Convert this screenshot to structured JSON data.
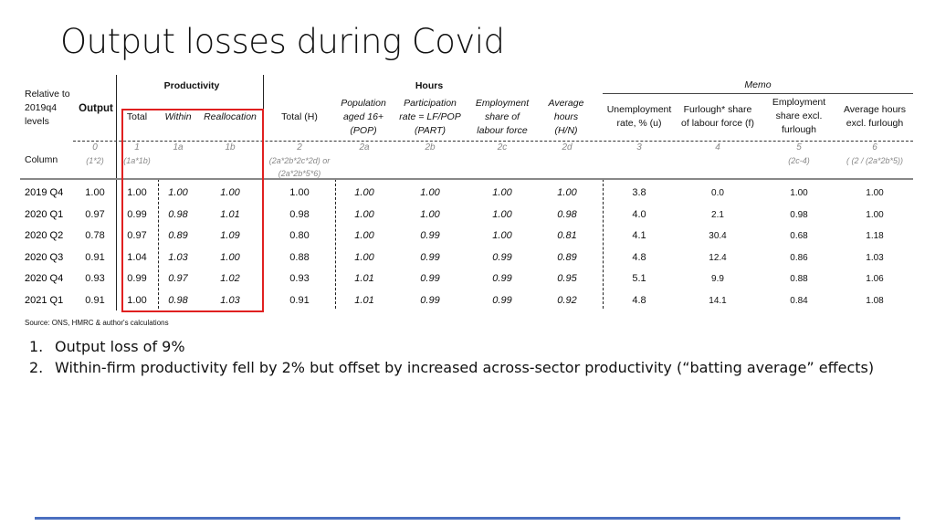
{
  "title": "Output losses during Covid",
  "table": {
    "row_header_label": "Relative to 2019q4 levels",
    "column_row_label": "Column",
    "groups": {
      "productivity": "Productivity",
      "hours": "Hours",
      "memo": "Memo"
    },
    "columns": [
      {
        "key": "output",
        "label": "Output",
        "id": "0",
        "formula": "(1*2)"
      },
      {
        "key": "prod_total",
        "label": "Total",
        "id": "1",
        "formula": "(1a*1b)"
      },
      {
        "key": "prod_within",
        "label": "Within",
        "id": "1a",
        "formula": ""
      },
      {
        "key": "prod_realloc",
        "label": "Reallocation",
        "id": "1b",
        "formula": ""
      },
      {
        "key": "hours_total",
        "label": "Total (H)",
        "id": "2",
        "formula": "(2a*2b*2c*2d) or",
        "formula2": "(2a*2b*5*6)"
      },
      {
        "key": "pop",
        "label_lines": [
          "Population",
          "aged 16+",
          "(POP)"
        ],
        "id": "2a",
        "formula": ""
      },
      {
        "key": "part",
        "label_lines": [
          "Participation",
          "rate = LF/POP",
          "(PART)"
        ],
        "id": "2b",
        "formula": ""
      },
      {
        "key": "emp_share",
        "label_lines": [
          "Employment",
          "share of",
          "labour force"
        ],
        "id": "2c",
        "formula": ""
      },
      {
        "key": "avg_hours",
        "label_lines": [
          "Average",
          "hours",
          "(H/N)"
        ],
        "id": "2d",
        "formula": ""
      },
      {
        "key": "unemp",
        "label_lines": [
          "Unemployment",
          "rate, % (u)"
        ],
        "id": "3",
        "formula": ""
      },
      {
        "key": "furlough",
        "label_lines": [
          "Furlough* share",
          "of labour force (f)"
        ],
        "id": "4",
        "formula": ""
      },
      {
        "key": "emp_excl",
        "label_lines": [
          "Employment",
          "share excl.",
          "furlough"
        ],
        "id": "5",
        "formula": "(2c-4)"
      },
      {
        "key": "hours_excl",
        "label_lines": [
          "Average hours",
          "excl. furlough"
        ],
        "id": "6",
        "formula": "( (2 / (2a*2b*5))"
      }
    ],
    "rows": [
      {
        "period": "2019 Q4",
        "values": [
          "1.00",
          "1.00",
          "1.00",
          "1.00",
          "1.00",
          "1.00",
          "1.00",
          "1.00",
          "1.00",
          "3.8",
          "0.0",
          "1.00",
          "1.00"
        ]
      },
      {
        "period": "2020 Q1",
        "values": [
          "0.97",
          "0.99",
          "0.98",
          "1.01",
          "0.98",
          "1.00",
          "1.00",
          "1.00",
          "0.98",
          "4.0",
          "2.1",
          "0.98",
          "1.00"
        ]
      },
      {
        "period": "2020 Q2",
        "values": [
          "0.78",
          "0.97",
          "0.89",
          "1.09",
          "0.80",
          "1.00",
          "0.99",
          "1.00",
          "0.81",
          "4.1",
          "30.4",
          "0.68",
          "1.18"
        ]
      },
      {
        "period": "2020 Q3",
        "values": [
          "0.91",
          "1.04",
          "1.03",
          "1.00",
          "0.88",
          "1.00",
          "0.99",
          "0.99",
          "0.89",
          "4.8",
          "12.4",
          "0.86",
          "1.03"
        ]
      },
      {
        "period": "2020 Q4",
        "values": [
          "0.93",
          "0.99",
          "0.97",
          "1.02",
          "0.93",
          "1.01",
          "0.99",
          "0.99",
          "0.95",
          "5.1",
          "9.9",
          "0.88",
          "1.06"
        ]
      },
      {
        "period": "2021 Q1",
        "values": [
          "0.91",
          "1.00",
          "0.98",
          "1.03",
          "0.91",
          "1.01",
          "0.99",
          "0.99",
          "0.92",
          "4.8",
          "14.1",
          "0.84",
          "1.08"
        ]
      }
    ],
    "highlight_color": "#e02020"
  },
  "source": "Source: ONS, HMRC & author's calculations",
  "bullets": [
    {
      "num": "1.",
      "text": "Output loss of 9%"
    },
    {
      "num": "2.",
      "text": "Within-firm productivity fell by 2% but offset by increased across-sector productivity (“batting average” effects)"
    }
  ],
  "footer_line_color": "#4a6fc0"
}
